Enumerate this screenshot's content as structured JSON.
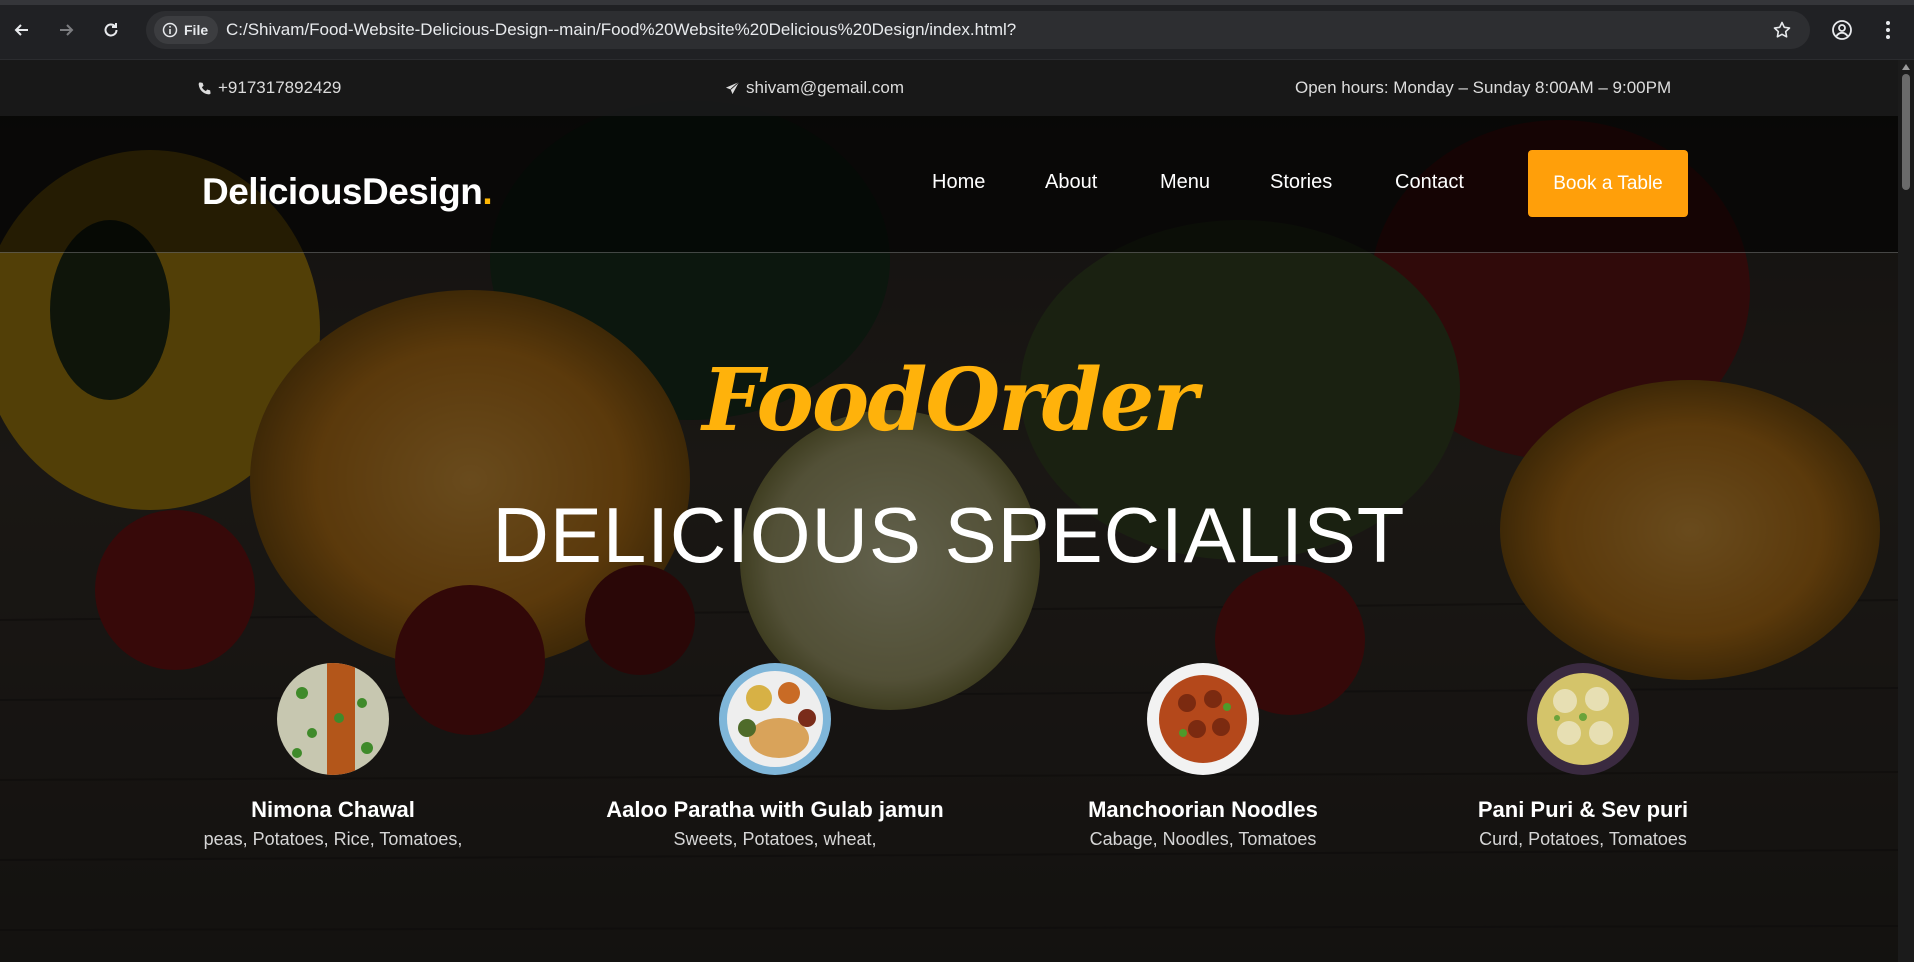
{
  "browser": {
    "site_chip_label": "File",
    "url": "C:/Shivam/Food-Website-Delicious-Design--main/Food%20Website%20Delicious%20Design/index.html?"
  },
  "topbar": {
    "phone": "+917317892429",
    "email": "shivam@gemail.com",
    "hours": "Open hours: Monday – Sunday 8:00AM – 9:00PM"
  },
  "header": {
    "logo_text": "DeliciousDesign",
    "logo_dot": ".",
    "nav": [
      "Home",
      "About",
      "Menu",
      "Stories",
      "Contact"
    ],
    "cta_label": "Book a Table"
  },
  "hero": {
    "script_title": "FoodOrder",
    "title": "DELICIOUS SPECIALIST"
  },
  "dishes": [
    {
      "name": "Nimona Chawal",
      "ingredients": "peas, Potatoes, Rice, Tomatoes,"
    },
    {
      "name": "Aaloo Paratha with Gulab jamun",
      "ingredients": "Sweets, Potatoes, wheat,"
    },
    {
      "name": "Manchoorian Noodles",
      "ingredients": "Cabage, Noodles, Tomatoes"
    },
    {
      "name": "Pani Puri & Sev puri",
      "ingredients": "Curd, Potatoes, Tomatoes"
    }
  ],
  "colors": {
    "accent": "#ffb703",
    "button": "#ff9f0a",
    "script_title": "#ffb20b"
  },
  "icons": {
    "phone": "phone-icon",
    "email": "paper-plane-icon"
  }
}
